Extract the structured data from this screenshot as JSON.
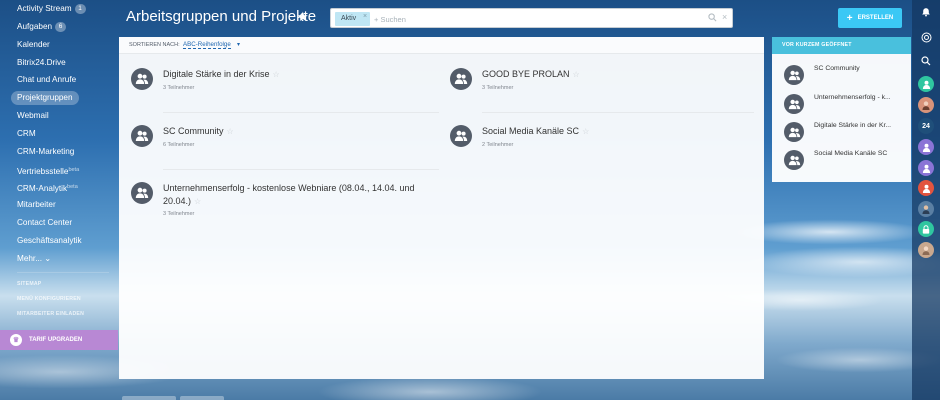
{
  "left_menu": {
    "items": [
      {
        "label": "Activity Stream",
        "counter": "1"
      },
      {
        "label": "Aufgaben",
        "counter": "6"
      },
      {
        "label": "Kalender"
      },
      {
        "label": "Bitrix24.Drive"
      },
      {
        "label": "Chat und Anrufe"
      },
      {
        "label": "Projektgruppen",
        "active": true
      },
      {
        "label": "Webmail"
      },
      {
        "label": "CRM"
      },
      {
        "label": "CRM-Marketing"
      },
      {
        "label": "Vertriebsstelle",
        "beta": "beta"
      },
      {
        "label": "CRM-Analytik",
        "beta": "beta"
      },
      {
        "label": "Mitarbeiter"
      },
      {
        "label": "Contact Center"
      },
      {
        "label": "Geschäftsanalytik"
      },
      {
        "label": "Mehr...",
        "suffix": "⌄"
      }
    ],
    "links": [
      "SITEMAP",
      "MENÜ KONFIGURIEREN",
      "MITARBEITER EINLADEN"
    ],
    "upgrade_label": "TARIF UPGRADEN"
  },
  "header": {
    "title": "Arbeitsgruppen und Projekte",
    "filter_chip": "Aktiv",
    "search_placeholder": "+ Suchen",
    "create_label": "ERSTELLEN"
  },
  "sort": {
    "label": "SORTIEREN NACH:",
    "value": "ABC-Reihenfolge"
  },
  "groups": [
    {
      "name": "Digitale Stärke in der Krise",
      "members": "3 Teilnehmer"
    },
    {
      "name": "GOOD BYE PROLAN",
      "members": "3 Teilnehmer"
    },
    {
      "name": "SC Community",
      "members": "6 Teilnehmer"
    },
    {
      "name": "Social Media Kanäle SC",
      "members": "2 Teilnehmer"
    },
    {
      "name": "Unternehmenserfolg - kostenlose Webniare (08.04., 14.04. und 20.04.)",
      "members": "3 Teilnehmer"
    }
  ],
  "recent": {
    "header": "VOR KURZEM GEÖFFNET",
    "items": [
      {
        "name": "SC Community"
      },
      {
        "name": "Unternehmenserfolg - k..."
      },
      {
        "name": "Digitale Stärke in der Kr..."
      },
      {
        "name": "Social Media Kanäle SC"
      }
    ]
  },
  "right_bar": {
    "counter": "24",
    "icons": [
      "bell-icon",
      "help-icon",
      "search-icon",
      "user-green-icon",
      "avatar-1",
      "counter",
      "user-violet-icon",
      "user-violet-icon-2",
      "user-red-icon",
      "avatar-2",
      "lock-icon",
      "avatar-3"
    ]
  },
  "colors": {
    "accent": "#3bc8f5",
    "recent_header": "#49c0dd",
    "upgrade": "#b888d4",
    "group_avatar": "#535c69"
  }
}
